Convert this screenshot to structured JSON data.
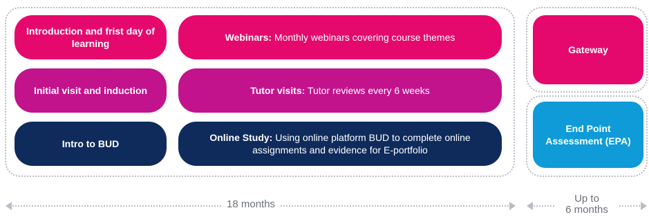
{
  "left_column": [
    {
      "label": "Introduction and frist day of learning",
      "color": "#e5096d"
    },
    {
      "label": "Initial visit and induction",
      "color": "#c2138c"
    },
    {
      "label": "Intro to BUD",
      "color": "#0e2b5c"
    }
  ],
  "activities": [
    {
      "title": "Webinars:",
      "text": "Monthly webinars covering course themes",
      "color": "#e5096d"
    },
    {
      "title": "Tutor visits:",
      "text": "Tutor reviews every 6 weeks",
      "color": "#c2138c"
    },
    {
      "title": "Online Study:",
      "text": "Using online platform BUD to complete online assignments and evidence for E-portfolio",
      "color": "#0e2b5c"
    }
  ],
  "right_column": [
    {
      "label": "Gateway",
      "color": "#e5096d"
    },
    {
      "label": "End Point Assessment (EPA)",
      "color": "#0e9bd8"
    }
  ],
  "timeline": {
    "main_duration": "18 months",
    "end_line1": "Up to",
    "end_line2": "6 months"
  },
  "colors": {
    "pink": "#e5096d",
    "magenta": "#c2138c",
    "navy": "#0e2b5c",
    "blue": "#0e9bd8",
    "dotted_border": "#b8bcc4"
  }
}
